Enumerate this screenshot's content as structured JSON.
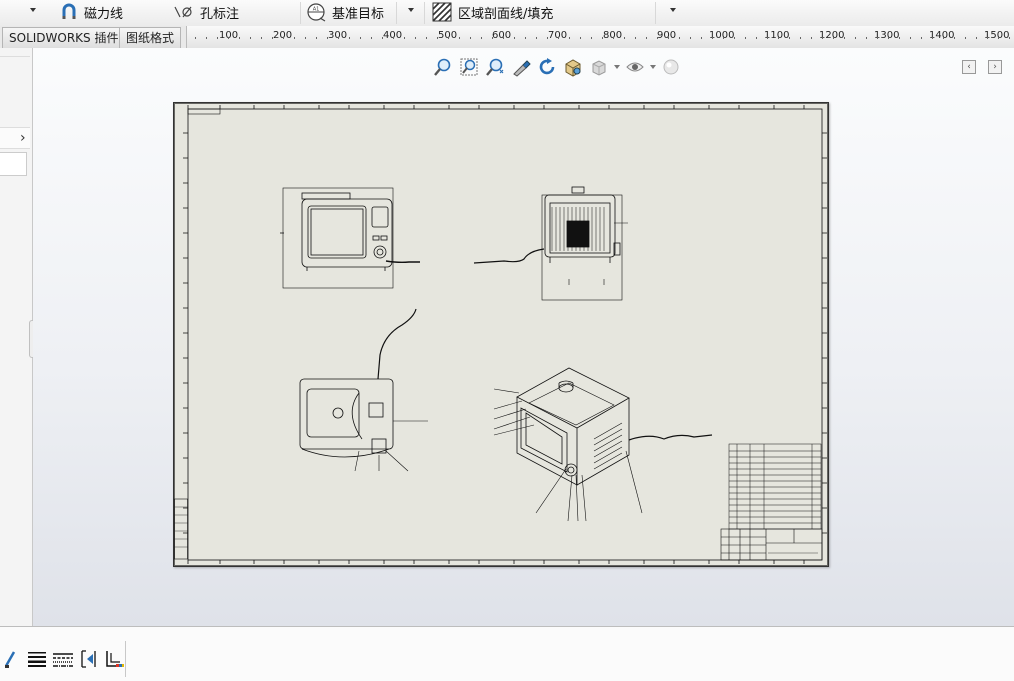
{
  "toolbar": {
    "items": [
      {
        "label": "磁力线",
        "icon": "magnet-line-icon"
      },
      {
        "label": "孔标注",
        "icon": "hole-callout-icon"
      },
      {
        "label": "基准目标",
        "icon": "datum-target-icon"
      },
      {
        "label": "区域剖面线/填充",
        "icon": "hatch-fill-icon"
      }
    ]
  },
  "tabs": [
    {
      "label": "SOLIDWORKS 插件"
    },
    {
      "label": "图纸格式"
    }
  ],
  "ruler": {
    "ticks": [
      "100",
      "200",
      "300",
      "400",
      "500",
      "600",
      "700",
      "800",
      "900",
      "1000",
      "1100",
      "1200",
      "1300",
      "1400",
      "1500"
    ]
  },
  "heads_up": {
    "icons": [
      "zoom-to-fit-icon",
      "zoom-to-area-icon",
      "zoom-in-out-icon",
      "pan-icon",
      "rotate-icon",
      "view-orientation-icon",
      "display-style-icon",
      "hide-show-icon",
      "appearance-icon"
    ]
  },
  "colors": {
    "sheet": "#e6e6de",
    "background_top": "#fbfcfd",
    "background_bottom": "#dfe2e9",
    "accent_blue": "#2a6fb5"
  },
  "bottom_toolbar": {
    "icons": [
      "line-format-icon",
      "line-thickness-icon",
      "line-style-icon",
      "hide-show-edges-icon",
      "color-display-mode-icon"
    ]
  }
}
